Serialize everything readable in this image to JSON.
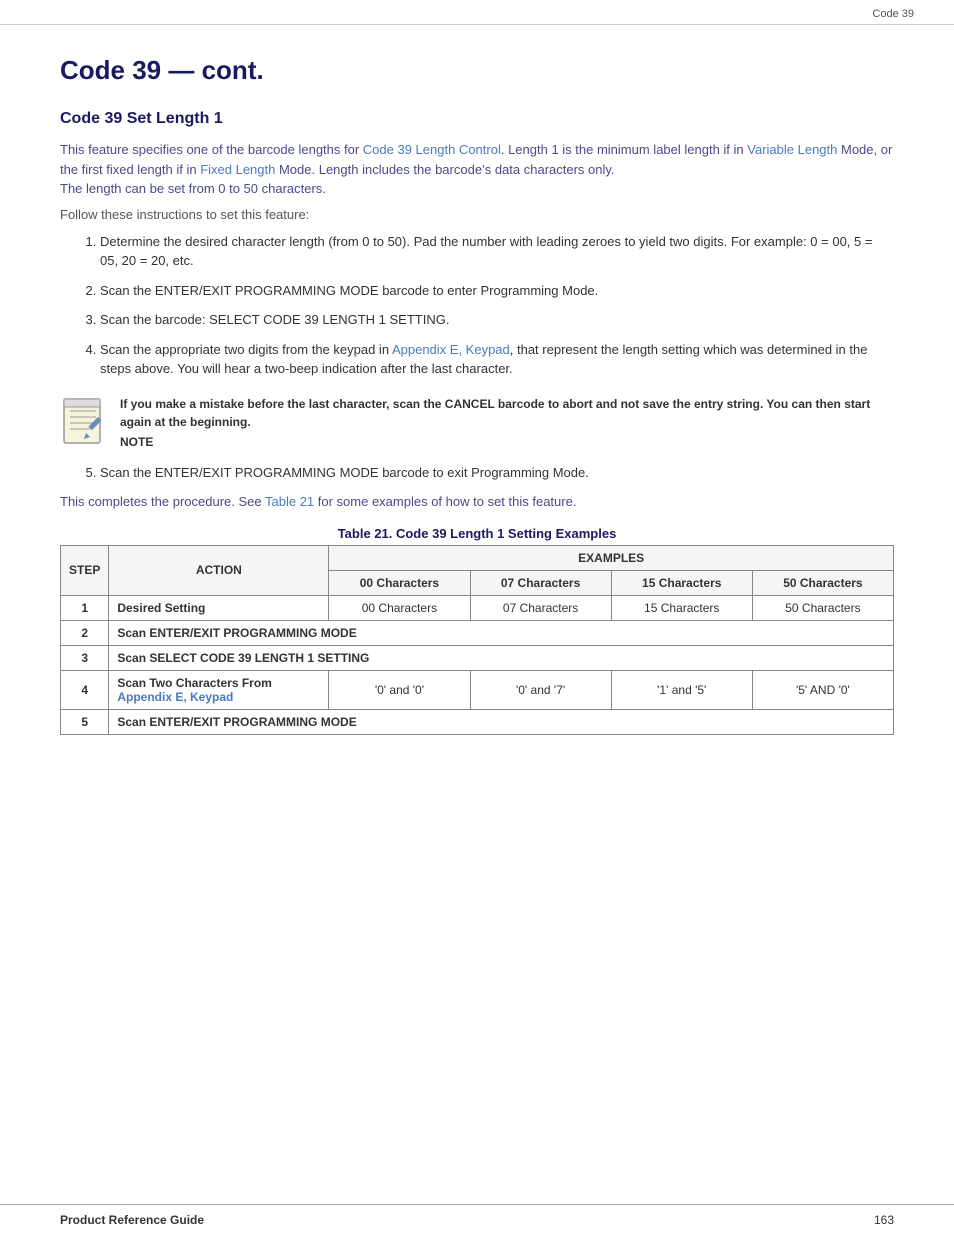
{
  "header": {
    "top_right": "Code 39"
  },
  "page_title": "Code 39 — cont.",
  "section": {
    "heading": "Code 39 Set Length 1",
    "intro_text_1": "This feature specifies one of the barcode lengths for ",
    "intro_link_1": "Code 39 Length Control",
    "intro_text_2": ". Length 1 is the minimum label length if in ",
    "intro_link_2": "Variable Length",
    "intro_text_3": " Mode, or the first fixed length if in ",
    "intro_link_3": "Fixed Length",
    "intro_text_4": " Mode. Length includes the barcode’s data characters only.",
    "intro_text_5": "The length can be set from 0 to 50 characters.",
    "instructions_intro": "Follow these instructions to set this feature:",
    "steps": [
      "Determine the desired character length (from 0 to 50). Pad the number with leading zeroes to yield two digits. For example: 0 = 00, 5 = 05, 20 = 20, etc.",
      "Scan the ENTER/EXIT PROGRAMMING MODE barcode to enter Programming Mode.",
      "Scan the barcode: SELECT CODE 39 LENGTH 1 SETTING.",
      "Scan the appropriate two digits from the keypad in Appendix E, Keypad, that represent the length setting which was determined in the steps above. You will hear a two-beep indication after the last character.",
      "Scan the ENTER/EXIT PROGRAMMING MODE barcode to exit Programming Mode."
    ],
    "step4_link": "Appendix E, Keypad",
    "note_text": "If you make a mistake before the last character, scan the CANCEL barcode to abort and not save the entry string. You can then start again at the beginning.",
    "note_label": "NOTE",
    "completion_text_1": "This completes the procedure. See ",
    "completion_link": "Table 21",
    "completion_text_2": " for some examples of how to set this feature."
  },
  "table": {
    "title": "Table 21. Code 39 Length 1 Setting Examples",
    "col_step": "STEP",
    "col_action": "ACTION",
    "col_examples": "EXAMPLES",
    "rows": [
      {
        "step": "1",
        "action": "Desired Setting",
        "is_action_bold": true,
        "values": [
          "00 Characters",
          "07 Characters",
          "15 Characters",
          "50 Characters"
        ],
        "span": false
      },
      {
        "step": "2",
        "action": "Scan ENTER/EXIT PROGRAMMING MODE",
        "is_action_bold": true,
        "values": [],
        "span": true
      },
      {
        "step": "3",
        "action": "Scan SELECT CODE 39 LENGTH 1 SETTING",
        "is_action_bold": true,
        "values": [],
        "span": true
      },
      {
        "step": "4",
        "action": "Scan Two Characters From\nAppendix E, Keypad",
        "has_link": true,
        "link_part": "Appendix E, Keypad",
        "is_action_bold": true,
        "values": [
          "'0' and '0'",
          "'0' and '7'",
          "'1' and '5'",
          "'5' AND '0'"
        ],
        "span": false
      },
      {
        "step": "5",
        "action": "Scan ENTER/EXIT PROGRAMMING MODE",
        "is_action_bold": true,
        "values": [],
        "span": true
      }
    ]
  },
  "footer": {
    "left": "Product Reference Guide",
    "right": "163"
  }
}
